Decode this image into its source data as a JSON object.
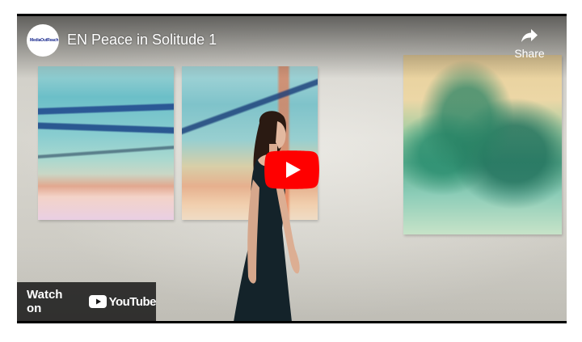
{
  "video": {
    "title": "EN Peace in Solitude 1",
    "channel_avatar_text": "MediaOutReach",
    "share_label": "Share",
    "watch_on_label": "Watch on",
    "youtube_label": "YouTube"
  },
  "icons": {
    "share": "share-arrow-icon",
    "play": "youtube-play-icon",
    "youtube_logo": "youtube-logo-icon"
  },
  "colors": {
    "play_red": "#ff0000",
    "overlay_dark": "#171717",
    "text": "#ffffff"
  }
}
